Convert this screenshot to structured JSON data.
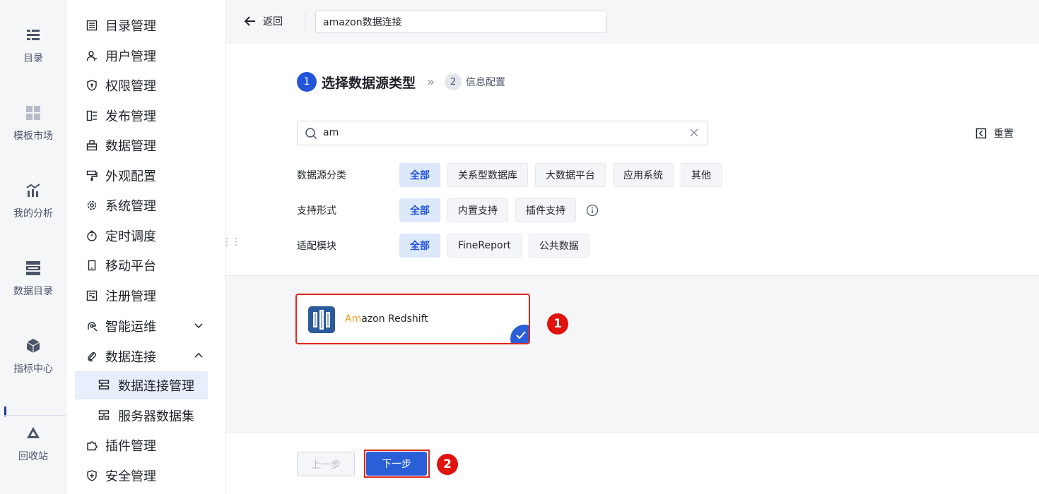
{
  "rail": {
    "items": [
      {
        "label": "目录",
        "icon": "list-icon"
      },
      {
        "label": "模板市场",
        "icon": "template-grid-icon"
      },
      {
        "label": "我的分析",
        "icon": "analysis-chart-icon"
      },
      {
        "label": "数据目录",
        "icon": "data-catalog-icon"
      },
      {
        "label": "指标中心",
        "icon": "metric-cube-icon"
      },
      {
        "label": "回收站",
        "icon": "recycle-icon"
      }
    ]
  },
  "nav": {
    "items": [
      {
        "label": "目录管理",
        "icon": "catalog-icon"
      },
      {
        "label": "用户管理",
        "icon": "user-icon"
      },
      {
        "label": "权限管理",
        "icon": "shield-key-icon"
      },
      {
        "label": "发布管理",
        "icon": "publish-icon"
      },
      {
        "label": "数据管理",
        "icon": "data-box-icon"
      },
      {
        "label": "外观配置",
        "icon": "paint-roller-icon"
      },
      {
        "label": "系统管理",
        "icon": "gear-icon"
      },
      {
        "label": "定时调度",
        "icon": "timer-icon"
      },
      {
        "label": "移动平台",
        "icon": "mobile-icon"
      },
      {
        "label": "注册管理",
        "icon": "register-icon"
      },
      {
        "label": "智能运维",
        "icon": "ops-icon"
      },
      {
        "label": "数据连接",
        "icon": "paperclip-icon"
      },
      {
        "label": "插件管理",
        "icon": "puzzle-icon"
      },
      {
        "label": "安全管理",
        "icon": "security-shield-icon"
      }
    ],
    "subitems": [
      {
        "label": "数据连接管理",
        "icon": "connection-icon",
        "active": true
      },
      {
        "label": "服务器数据集",
        "icon": "server-dataset-icon",
        "active": false
      }
    ]
  },
  "topbar": {
    "back_label": "返回",
    "connection_name": "amazon数据连接"
  },
  "steps": [
    {
      "num": "1",
      "label": "选择数据源类型"
    },
    {
      "num": "2",
      "label": "信息配置"
    }
  ],
  "search": {
    "value": "am"
  },
  "reset_label": "重置",
  "filters": {
    "category": {
      "label": "数据源分类",
      "options": [
        "全部",
        "关系型数据库",
        "大数据平台",
        "应用系统",
        "其他"
      ],
      "selected": "全部"
    },
    "support": {
      "label": "支持形式",
      "options": [
        "全部",
        "内置支持",
        "插件支持"
      ],
      "selected": "全部"
    },
    "module": {
      "label": "适配模块",
      "options": [
        "全部",
        "FineReport",
        "公共数据"
      ],
      "selected": "全部"
    }
  },
  "result_card": {
    "name_highlight": "Am",
    "name_rest": "azon Redshift",
    "selected": true
  },
  "annotations": {
    "badge1": "1",
    "badge2": "2"
  },
  "buttons": {
    "prev": "上一步",
    "next": "下一步"
  },
  "colors": {
    "primary": "#2255d8",
    "annotation_red": "#e0120e",
    "highlight_orange": "#f0a020"
  }
}
